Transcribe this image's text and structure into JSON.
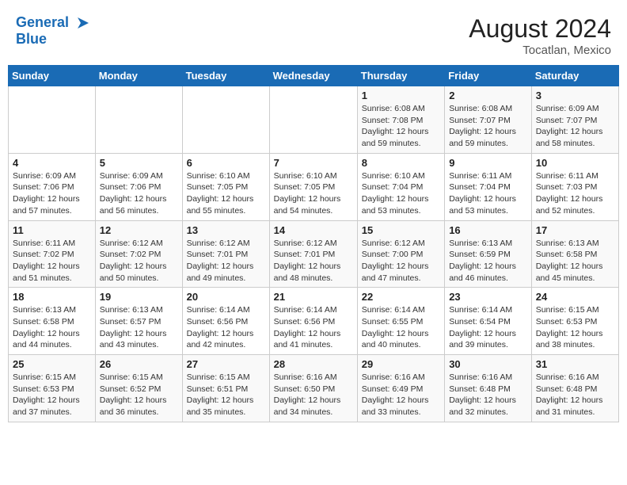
{
  "header": {
    "logo_line1": "General",
    "logo_line2": "Blue",
    "month_year": "August 2024",
    "location": "Tocatlan, Mexico"
  },
  "weekdays": [
    "Sunday",
    "Monday",
    "Tuesday",
    "Wednesday",
    "Thursday",
    "Friday",
    "Saturday"
  ],
  "weeks": [
    [
      {
        "day": "",
        "info": ""
      },
      {
        "day": "",
        "info": ""
      },
      {
        "day": "",
        "info": ""
      },
      {
        "day": "",
        "info": ""
      },
      {
        "day": "1",
        "info": "Sunrise: 6:08 AM\nSunset: 7:08 PM\nDaylight: 12 hours\nand 59 minutes."
      },
      {
        "day": "2",
        "info": "Sunrise: 6:08 AM\nSunset: 7:07 PM\nDaylight: 12 hours\nand 59 minutes."
      },
      {
        "day": "3",
        "info": "Sunrise: 6:09 AM\nSunset: 7:07 PM\nDaylight: 12 hours\nand 58 minutes."
      }
    ],
    [
      {
        "day": "4",
        "info": "Sunrise: 6:09 AM\nSunset: 7:06 PM\nDaylight: 12 hours\nand 57 minutes."
      },
      {
        "day": "5",
        "info": "Sunrise: 6:09 AM\nSunset: 7:06 PM\nDaylight: 12 hours\nand 56 minutes."
      },
      {
        "day": "6",
        "info": "Sunrise: 6:10 AM\nSunset: 7:05 PM\nDaylight: 12 hours\nand 55 minutes."
      },
      {
        "day": "7",
        "info": "Sunrise: 6:10 AM\nSunset: 7:05 PM\nDaylight: 12 hours\nand 54 minutes."
      },
      {
        "day": "8",
        "info": "Sunrise: 6:10 AM\nSunset: 7:04 PM\nDaylight: 12 hours\nand 53 minutes."
      },
      {
        "day": "9",
        "info": "Sunrise: 6:11 AM\nSunset: 7:04 PM\nDaylight: 12 hours\nand 53 minutes."
      },
      {
        "day": "10",
        "info": "Sunrise: 6:11 AM\nSunset: 7:03 PM\nDaylight: 12 hours\nand 52 minutes."
      }
    ],
    [
      {
        "day": "11",
        "info": "Sunrise: 6:11 AM\nSunset: 7:02 PM\nDaylight: 12 hours\nand 51 minutes."
      },
      {
        "day": "12",
        "info": "Sunrise: 6:12 AM\nSunset: 7:02 PM\nDaylight: 12 hours\nand 50 minutes."
      },
      {
        "day": "13",
        "info": "Sunrise: 6:12 AM\nSunset: 7:01 PM\nDaylight: 12 hours\nand 49 minutes."
      },
      {
        "day": "14",
        "info": "Sunrise: 6:12 AM\nSunset: 7:01 PM\nDaylight: 12 hours\nand 48 minutes."
      },
      {
        "day": "15",
        "info": "Sunrise: 6:12 AM\nSunset: 7:00 PM\nDaylight: 12 hours\nand 47 minutes."
      },
      {
        "day": "16",
        "info": "Sunrise: 6:13 AM\nSunset: 6:59 PM\nDaylight: 12 hours\nand 46 minutes."
      },
      {
        "day": "17",
        "info": "Sunrise: 6:13 AM\nSunset: 6:58 PM\nDaylight: 12 hours\nand 45 minutes."
      }
    ],
    [
      {
        "day": "18",
        "info": "Sunrise: 6:13 AM\nSunset: 6:58 PM\nDaylight: 12 hours\nand 44 minutes."
      },
      {
        "day": "19",
        "info": "Sunrise: 6:13 AM\nSunset: 6:57 PM\nDaylight: 12 hours\nand 43 minutes."
      },
      {
        "day": "20",
        "info": "Sunrise: 6:14 AM\nSunset: 6:56 PM\nDaylight: 12 hours\nand 42 minutes."
      },
      {
        "day": "21",
        "info": "Sunrise: 6:14 AM\nSunset: 6:56 PM\nDaylight: 12 hours\nand 41 minutes."
      },
      {
        "day": "22",
        "info": "Sunrise: 6:14 AM\nSunset: 6:55 PM\nDaylight: 12 hours\nand 40 minutes."
      },
      {
        "day": "23",
        "info": "Sunrise: 6:14 AM\nSunset: 6:54 PM\nDaylight: 12 hours\nand 39 minutes."
      },
      {
        "day": "24",
        "info": "Sunrise: 6:15 AM\nSunset: 6:53 PM\nDaylight: 12 hours\nand 38 minutes."
      }
    ],
    [
      {
        "day": "25",
        "info": "Sunrise: 6:15 AM\nSunset: 6:53 PM\nDaylight: 12 hours\nand 37 minutes."
      },
      {
        "day": "26",
        "info": "Sunrise: 6:15 AM\nSunset: 6:52 PM\nDaylight: 12 hours\nand 36 minutes."
      },
      {
        "day": "27",
        "info": "Sunrise: 6:15 AM\nSunset: 6:51 PM\nDaylight: 12 hours\nand 35 minutes."
      },
      {
        "day": "28",
        "info": "Sunrise: 6:16 AM\nSunset: 6:50 PM\nDaylight: 12 hours\nand 34 minutes."
      },
      {
        "day": "29",
        "info": "Sunrise: 6:16 AM\nSunset: 6:49 PM\nDaylight: 12 hours\nand 33 minutes."
      },
      {
        "day": "30",
        "info": "Sunrise: 6:16 AM\nSunset: 6:48 PM\nDaylight: 12 hours\nand 32 minutes."
      },
      {
        "day": "31",
        "info": "Sunrise: 6:16 AM\nSunset: 6:48 PM\nDaylight: 12 hours\nand 31 minutes."
      }
    ]
  ]
}
